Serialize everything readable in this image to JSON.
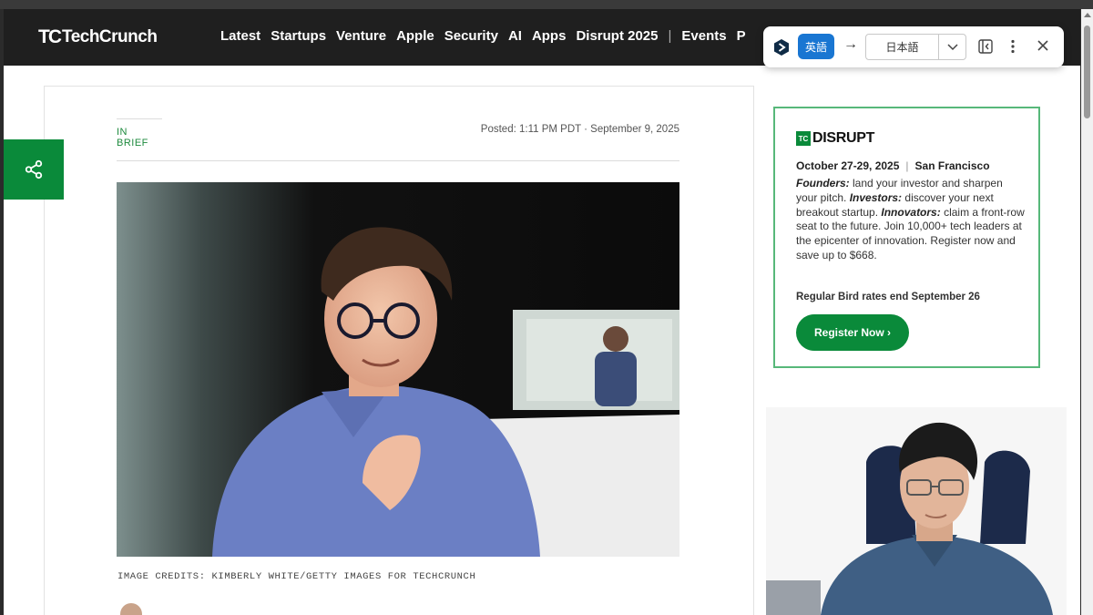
{
  "header": {
    "logo_mark": "TC",
    "logo_text": "TechCrunch",
    "nav": [
      "Latest",
      "Startups",
      "Venture",
      "Apple",
      "Security",
      "AI",
      "Apps",
      "Disrupt 2025",
      "Events",
      "P"
    ]
  },
  "article": {
    "section": "IN BRIEF",
    "posted": "Posted: 1:11 PM PDT · September 9, 2025",
    "image_credits": "IMAGE CREDITS: KIMBERLY WHITE/GETTY IMAGES FOR TECHCRUNCH"
  },
  "share": {
    "icon": "share-icon"
  },
  "ad": {
    "logo_mark": "TC",
    "logo_text": "DISRUPT",
    "dates": "October 27-29, 2025",
    "location": "San Francisco",
    "founders_label": "Founders:",
    "founders_text": " land your investor and sharpen your pitch. ",
    "investors_label": "Investors:",
    "investors_text": " discover your next breakout startup. ",
    "innovators_label": "Innovators:",
    "innovators_text": " claim a front-row seat to the future. Join 10,000+ tech leaders at the epicenter of innovation. Register now and save up to $668.",
    "rates": "Regular Bird rates end September 26",
    "button": "Register Now ›"
  },
  "translator": {
    "source_lang": "英語",
    "target_lang": "日本語",
    "icons": [
      "translate-logo-icon",
      "arrow-right-icon",
      "chevron-down-icon",
      "sidebar-toggle-icon",
      "more-vert-icon",
      "close-icon"
    ]
  },
  "colors": {
    "brand_green": "#0a8a3a",
    "header_bg": "#1f1f1f",
    "translate_blue": "#1976d2"
  }
}
